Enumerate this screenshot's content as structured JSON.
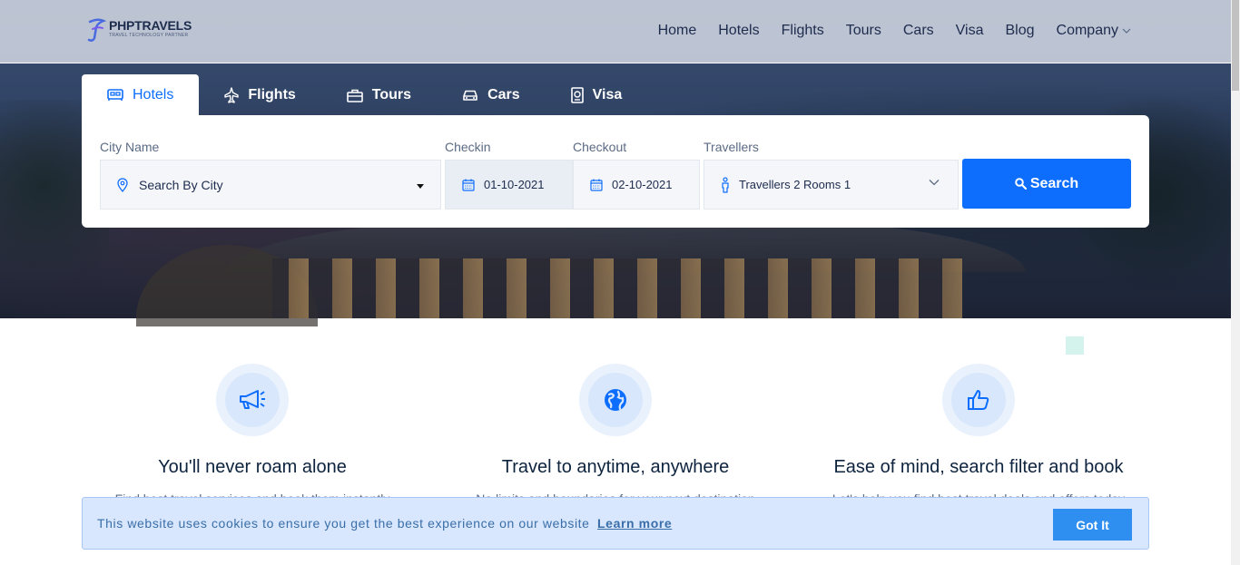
{
  "brand": {
    "name": "PHPTRAVELS",
    "tagline": "TRAVEL TECHNOLOGY PARTNER",
    "accent": "#0d6efd"
  },
  "nav": {
    "items": [
      {
        "label": "Home"
      },
      {
        "label": "Hotels"
      },
      {
        "label": "Flights"
      },
      {
        "label": "Tours"
      },
      {
        "label": "Cars"
      },
      {
        "label": "Visa"
      },
      {
        "label": "Blog"
      },
      {
        "label": "Company"
      }
    ]
  },
  "tabs": [
    {
      "label": "Hotels",
      "icon": "bed-icon",
      "active": true
    },
    {
      "label": "Flights",
      "icon": "plane-icon",
      "active": false
    },
    {
      "label": "Tours",
      "icon": "suitcase-icon",
      "active": false
    },
    {
      "label": "Cars",
      "icon": "car-icon",
      "active": false
    },
    {
      "label": "Visa",
      "icon": "passport-icon",
      "active": false
    }
  ],
  "search": {
    "city_label": "City Name",
    "city_value": "Search By City",
    "checkin_label": "Checkin",
    "checkin_value": "01-10-2021",
    "checkout_label": "Checkout",
    "checkout_value": "02-10-2021",
    "travellers_label": "Travellers",
    "travellers_value": "Travellers 2 Rooms 1",
    "button_label": "Search"
  },
  "features": [
    {
      "icon": "megaphone-icon",
      "title": "You'll never roam alone",
      "text": "Find best travel services and book them instantly"
    },
    {
      "icon": "globe-icon",
      "title": "Travel to anytime, anywhere",
      "text": "No limits and boundaries for your next destination"
    },
    {
      "icon": "thumbs-up-icon",
      "title": "Ease of mind, search filter and book",
      "text": "Let's help you find best travel deals and offers today"
    }
  ],
  "cookie": {
    "message": "This website uses cookies to ensure you get the best experience on our website",
    "learn_more": "Learn more",
    "button": "Got It"
  }
}
